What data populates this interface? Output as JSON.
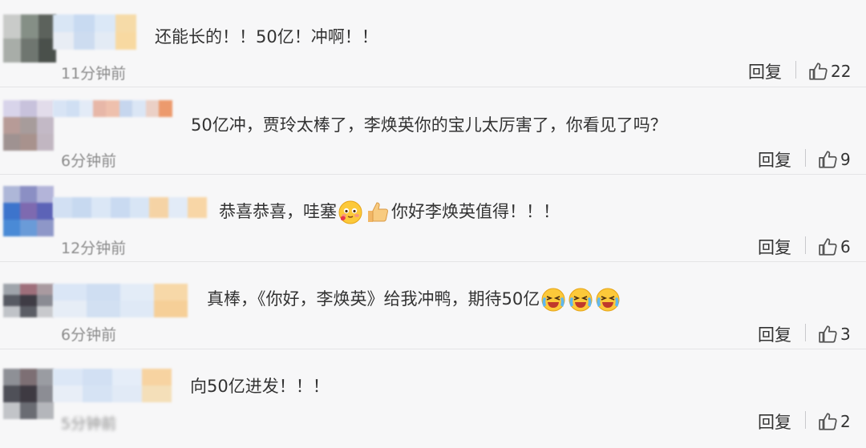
{
  "comments": [
    {
      "text": "还能长的！！50亿！冲啊！！",
      "time": "11分钟前",
      "reply_label": "回复",
      "likes": "22",
      "avatar_colors": [
        "#c9cbc9",
        "#858f86",
        "#5c625c",
        "#a8ada8",
        "#6f7670",
        "#4a504b"
      ],
      "name_colors": [
        "#d9e6f5",
        "#c8daf1",
        "#dbe8f7",
        "#f6dba8",
        "#e8edf4",
        "#cddcf0",
        "#e3ebf5",
        "#f8d9a1"
      ],
      "emojis": []
    },
    {
      "text": "50亿冲，贾玲太棒了，李焕英你的宝儿太厉害了，你看见了吗？",
      "time": "6分钟前",
      "reply_label": "回复",
      "likes": "9",
      "avatar_colors": [
        "#d8d4ea",
        "#c8c2dc",
        "#e2dcea",
        "#b79b97",
        "#a79c9b",
        "#c3b9c6",
        "#9f9291",
        "#a8928d",
        "#c1b6c1"
      ],
      "name_colors": [
        "#d8e4f5",
        "#d0dff3",
        "#e3ebf7",
        "#e7b7a8",
        "#eec0ad",
        "#c6d6ee",
        "#dbe6f5",
        "#ebd0c6",
        "#ec9a6d"
      ],
      "emojis": []
    },
    {
      "text_before": "恭喜恭喜，哇塞",
      "text_after": "你好李焕英值得！！！",
      "time": "12分钟前",
      "reply_label": "回复",
      "likes": "6",
      "avatar_colors": [
        "#aeb7d8",
        "#8b8fc4",
        "#b3b4d9",
        "#3d74cc",
        "#7e6ab0",
        "#5c63b7",
        "#4a8ad6",
        "#6a9bd8",
        "#8e97c8"
      ],
      "name_colors": [
        "#d2e0f3",
        "#c7d9f0",
        "#dbe7f6",
        "#c9daf1",
        "#d8e5f5",
        "#f5d3a5",
        "#e2ebf7",
        "#f8d6a6"
      ],
      "emojis": [
        "blush-emoji",
        "thumbs-up-emoji"
      ]
    },
    {
      "text": "真棒，《你好，李焕英》给我冲鸭，期待50亿",
      "time": "6分钟前",
      "reply_label": "回复",
      "likes": "3",
      "avatar_colors": [
        "#9fa4ab",
        "#9e6f7b",
        "#a99aa0",
        "#575a63",
        "#3f3c45",
        "#8a8b93",
        "#c0c3c8",
        "#5b5d65",
        "#c8c9cd"
      ],
      "name_colors": [
        "#dae6f6",
        "#cfdef2",
        "#e3ecf7",
        "#f7d8a8",
        "#e6edf6",
        "#d2e0f2",
        "#dfe9f6",
        "#f6cf98"
      ],
      "emojis": [
        "crying-laugh-emoji",
        "crying-laugh-emoji",
        "crying-laugh-emoji"
      ]
    },
    {
      "text": "向50亿进发！！！",
      "time": "5分钟前",
      "reply_label": "回复",
      "likes": "2",
      "avatar_colors": [
        "#8e9096",
        "#7d6f74",
        "#9a9ca2",
        "#4f5058",
        "#3e3a42",
        "#8c8d94",
        "#c2c4c8",
        "#6a6c73",
        "#b4b6bb"
      ],
      "name_colors": [
        "#dce7f6",
        "#d2e0f3",
        "#e5edf8",
        "#f7d3a1",
        "#e8eef7",
        "#d6e3f4",
        "#e1eaf6",
        "#f4dfb9"
      ],
      "emojis": []
    }
  ],
  "colors": {
    "background": "#f7f7f8",
    "text": "#333333",
    "meta": "#8c8c8c",
    "separator": "#e4e4e6"
  }
}
